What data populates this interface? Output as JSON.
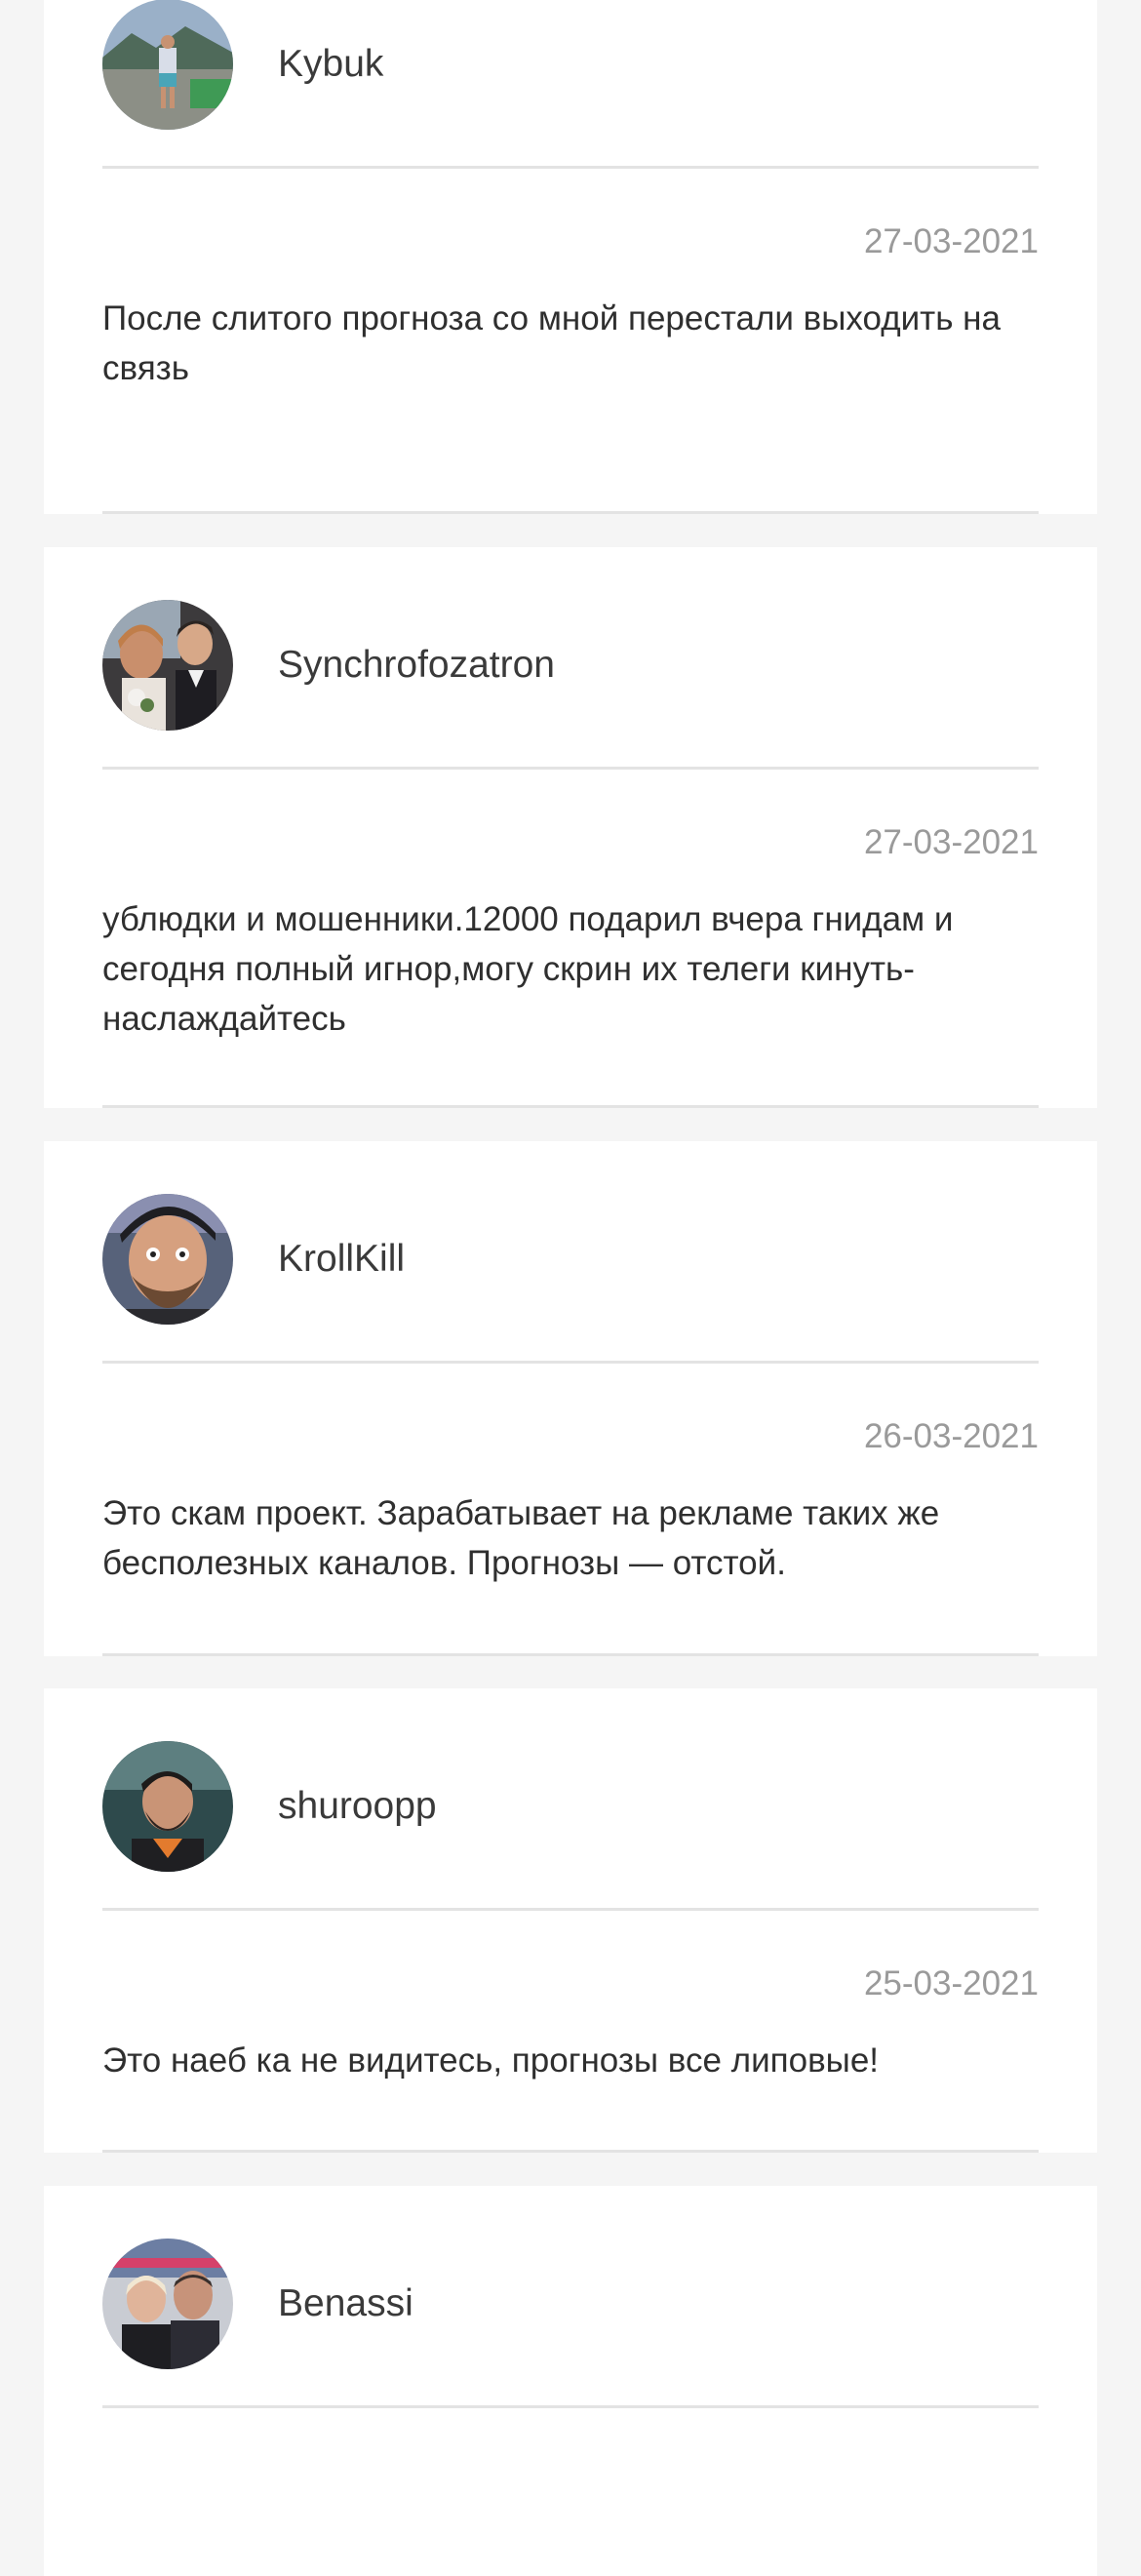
{
  "comments": [
    {
      "username": "Kybuk",
      "date": "27-03-2021",
      "text": "После слитого прогноза со мной перестали выходить на связь"
    },
    {
      "username": "Synchrofozatron",
      "date": "27-03-2021",
      "text": "ублюдки и мошенники.12000 подарил вчера гнидам и сегодня полный игнор,могу скрин их телеги кинуть-наслаждайтесь"
    },
    {
      "username": "KrollKill",
      "date": "26-03-2021",
      "text": "Это скам проект. Зарабатывает на рекламе таких же бесполезных каналов. Прогнозы — отстой."
    },
    {
      "username": "shuroopp",
      "date": "25-03-2021",
      "text": "Это наеб ка не видитесь, прогнозы все липовые!"
    },
    {
      "username": "Benassi"
    }
  ]
}
